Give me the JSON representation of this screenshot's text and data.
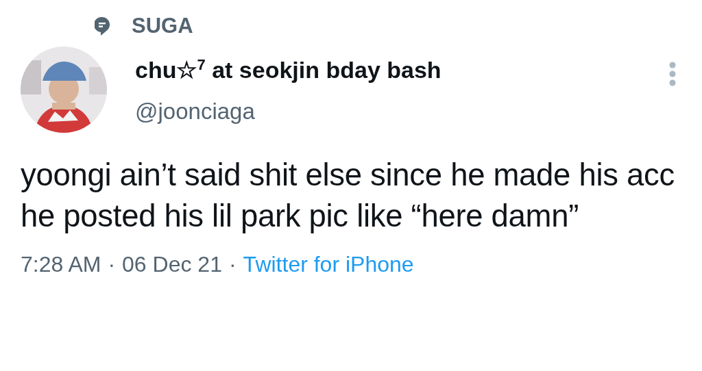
{
  "topic": {
    "label": "SUGA"
  },
  "author": {
    "display_name": "chu☆$^{7}$ at seokjin bday bash",
    "handle": "@joonciaga"
  },
  "tweet": {
    "text": "yoongi ain’t said shit else since he made his acc he posted his lil park pic like “here damn”"
  },
  "meta": {
    "time": "7:28 AM",
    "separator_1": "·",
    "date": "06 Dec 21",
    "separator_2": "·",
    "source": "Twitter for iPhone"
  }
}
